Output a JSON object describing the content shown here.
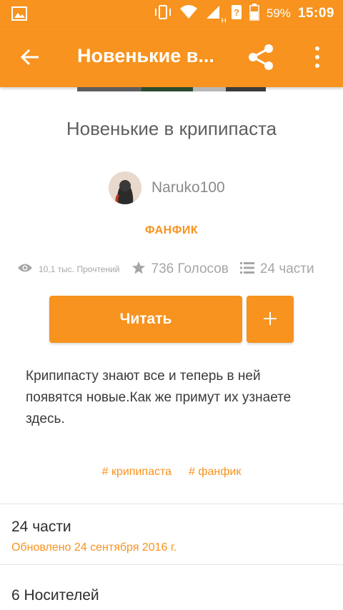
{
  "status_bar": {
    "battery_percent": "59%",
    "time": "15:09",
    "network_type": "H"
  },
  "toolbar": {
    "title": "Новенькие в...",
    "back_icon": "arrow-back-icon",
    "share_icon": "share-icon",
    "more_icon": "more-vert-icon"
  },
  "story": {
    "title": "Новенькие в крипипаста",
    "author": "Naruko100",
    "category": "ФАНФИК",
    "reads": "10,1 тыс. Прочтений",
    "votes": "736 Голосов",
    "parts": "24 части",
    "read_button": "Читать",
    "add_button": "+",
    "description": "Крипипасту знают все и теперь в ней появятся новые.Как же примут их узнаете здесь.",
    "tags": [
      "# крипипаста",
      "# фанфик"
    ]
  },
  "parts_section": {
    "title": "24 части",
    "updated": "Обновлено 24 сентября 2016 г."
  },
  "carriers_section": {
    "title": "6 Носителей"
  },
  "colors": {
    "accent": "#f7931e",
    "stat_gray": "#a6a6a6"
  }
}
